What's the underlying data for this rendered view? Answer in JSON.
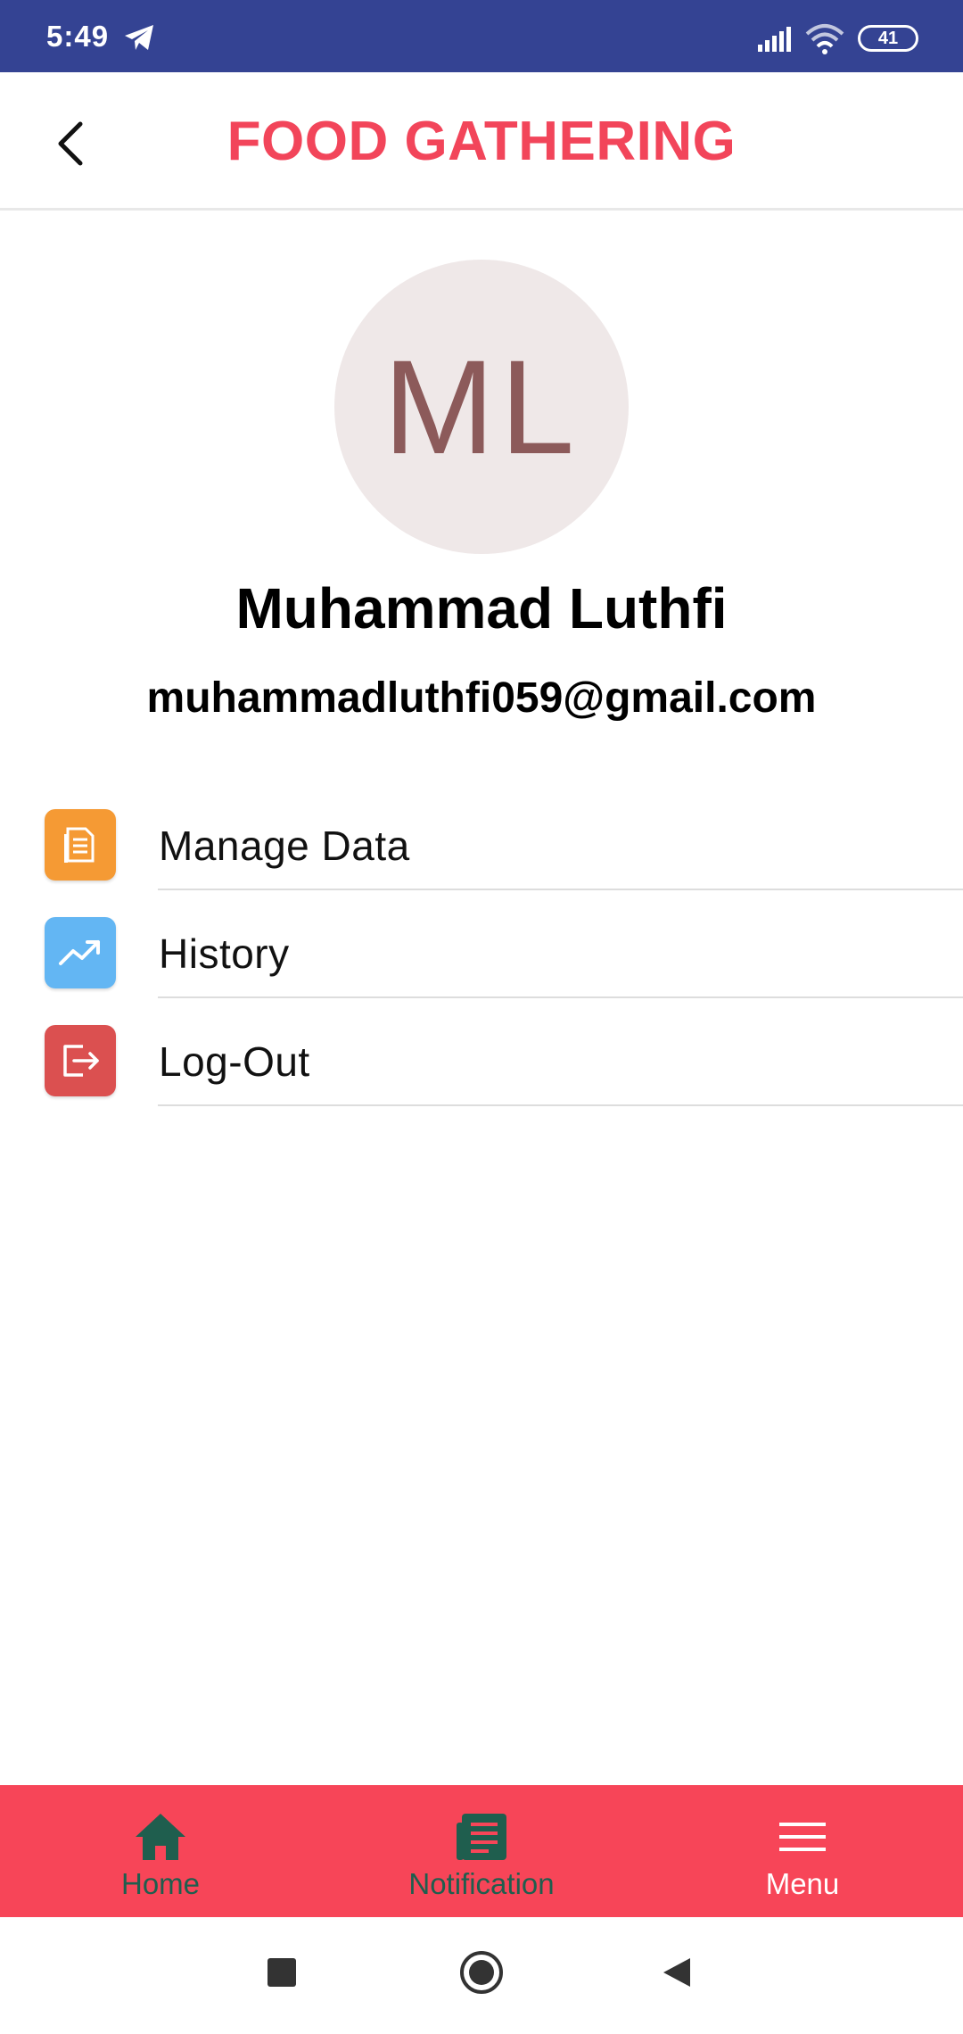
{
  "status_bar": {
    "time": "5:49",
    "battery": "41",
    "icons": [
      "telegram-icon",
      "signal-icon",
      "wifi-icon",
      "battery-icon"
    ]
  },
  "app_bar": {
    "title": "FOOD GATHERING",
    "back_icon": "chevron-left-icon"
  },
  "profile": {
    "initials": "ML",
    "name": "Muhammad Luthfi",
    "email": "muhammadluthfi059@gmail.com"
  },
  "menu": {
    "items": [
      {
        "label": "Manage Data",
        "icon": "document-icon",
        "color": "#f59a34"
      },
      {
        "label": "History",
        "icon": "trending-up-icon",
        "color": "#63b6f3"
      },
      {
        "label": "Log-Out",
        "icon": "logout-icon",
        "color": "#db5050"
      }
    ]
  },
  "bottom_nav": {
    "items": [
      {
        "label": "Home",
        "icon": "home-icon"
      },
      {
        "label": "Notification",
        "icon": "newspaper-icon"
      },
      {
        "label": "Menu",
        "icon": "menu-icon"
      }
    ]
  },
  "colors": {
    "status_bar": "#344393",
    "accent": "#f74558",
    "title": "#f2455a",
    "nav_inactive": "#1f5e4e",
    "nav_active": "#ffffff",
    "avatar_bg": "#efe8e8",
    "avatar_text": "#8c5a5a"
  }
}
